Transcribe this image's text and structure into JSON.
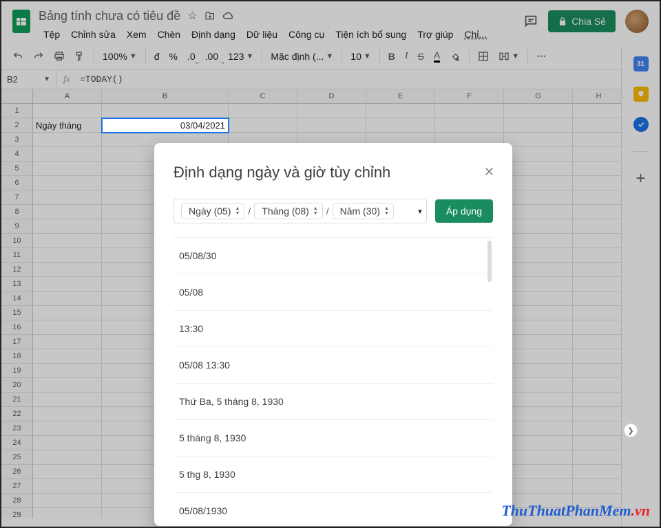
{
  "header": {
    "doc_title": "Bảng tính chưa có tiêu đề",
    "star_tooltip": "Star",
    "move_tooltip": "Move",
    "cloud_tooltip": "See document status",
    "share_label": "Chia Sẻ",
    "last_edit_short": "Chỉ..."
  },
  "menubar": [
    "Tệp",
    "Chỉnh sửa",
    "Xem",
    "Chèn",
    "Định dạng",
    "Dữ liệu",
    "Công cụ",
    "Tiện ích bổ sung",
    "Trợ giúp"
  ],
  "toolbar": {
    "zoom": "100%",
    "currency": "đ",
    "percent": "%",
    "dec_less": ".0",
    "dec_more": ".00",
    "more_formats": "123",
    "font": "Mặc định (...",
    "font_size": "10",
    "bold": "B",
    "italic": "I",
    "strike": "S",
    "text_color": "A"
  },
  "formula_bar": {
    "name_box": "B2",
    "fx_label": "fx",
    "formula": "=TODAY()"
  },
  "sheet": {
    "col_headers": [
      "A",
      "B",
      "C",
      "D",
      "E",
      "F",
      "G",
      "H"
    ],
    "row_count": 29,
    "cells": {
      "A2": "Ngày tháng",
      "B2": "03/04/2021"
    },
    "selected_cell": "B2"
  },
  "side_panel": {
    "calendar_badge": "31"
  },
  "modal": {
    "title": "Định dạng ngày và giờ tùy chỉnh",
    "chips": {
      "day": "Ngày (05)",
      "month": "Tháng (08)",
      "year": "Năm (30)"
    },
    "apply_label": "Áp dụng",
    "format_options": [
      "05/08/30",
      "05/08",
      "13:30",
      "05/08 13:30",
      "Thứ Ba, 5 tháng 8, 1930",
      "5 tháng 8, 1930",
      "5 thg 8, 1930",
      "05/08/1930"
    ]
  },
  "watermark": {
    "part1": "ThuThuatPhanMem",
    "part2": ".vn"
  }
}
